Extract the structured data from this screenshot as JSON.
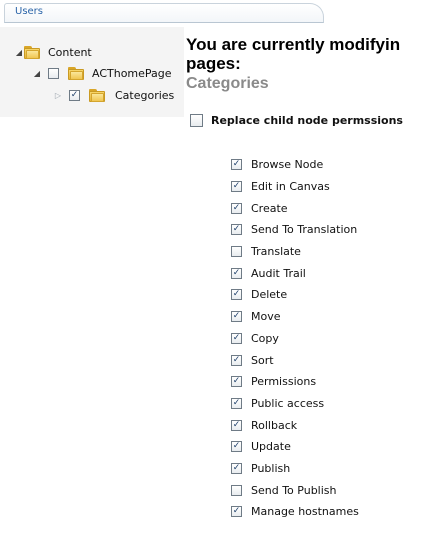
{
  "header": {
    "tab_label": "Users"
  },
  "tree": {
    "root": {
      "label": "Content"
    },
    "child": {
      "label": "ACThomePage",
      "checked": false
    },
    "grandchild": {
      "label": "Categories",
      "checked": true
    }
  },
  "main": {
    "title": "You are currently modifying pages:",
    "title_line1": "You are currently modifyin",
    "title_line2": "pages:",
    "subtitle": "Categories",
    "replace_label": "Replace child node permssions",
    "replace_checked": false,
    "permissions": [
      {
        "label": "Browse Node",
        "checked": true
      },
      {
        "label": "Edit in Canvas",
        "checked": true
      },
      {
        "label": "Create",
        "checked": true
      },
      {
        "label": "Send To Translation",
        "checked": true
      },
      {
        "label": "Translate",
        "checked": false
      },
      {
        "label": "Audit Trail",
        "checked": true
      },
      {
        "label": "Delete",
        "checked": true
      },
      {
        "label": "Move",
        "checked": true
      },
      {
        "label": "Copy",
        "checked": true
      },
      {
        "label": "Sort",
        "checked": true
      },
      {
        "label": "Permissions",
        "checked": true
      },
      {
        "label": "Public access",
        "checked": true
      },
      {
        "label": "Rollback",
        "checked": true
      },
      {
        "label": "Update",
        "checked": true
      },
      {
        "label": "Publish",
        "checked": true
      },
      {
        "label": "Send To Publish",
        "checked": false
      },
      {
        "label": "Manage hostnames",
        "checked": true
      }
    ]
  }
}
